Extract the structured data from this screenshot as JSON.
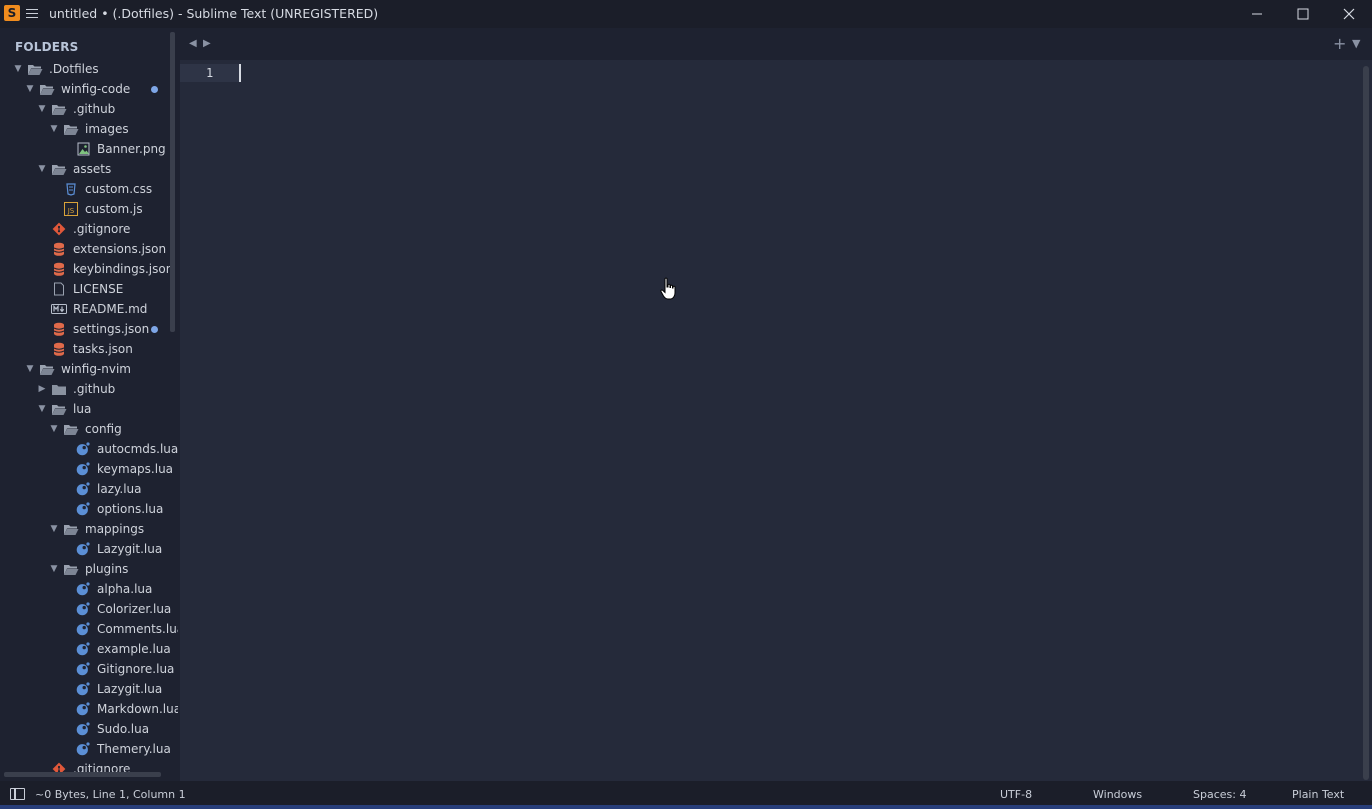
{
  "window": {
    "title": "untitled • (.Dotfiles) - Sublime Text (UNREGISTERED)",
    "app_icon": "S"
  },
  "sidebar": {
    "title": "FOLDERS",
    "items": [
      {
        "label": ".Dotfiles",
        "icon": "folder-open-icon",
        "expanded": true
      },
      {
        "label": "winfig-code",
        "icon": "folder-open-icon",
        "expanded": true,
        "modified": true
      },
      {
        "label": ".github",
        "icon": "folder-open-icon",
        "expanded": true
      },
      {
        "label": "images",
        "icon": "folder-open-icon",
        "expanded": true
      },
      {
        "label": "Banner.png",
        "icon": "image-file-icon"
      },
      {
        "label": "assets",
        "icon": "folder-open-icon",
        "expanded": true
      },
      {
        "label": "custom.css",
        "icon": "css-file-icon"
      },
      {
        "label": "custom.js",
        "icon": "js-file-icon"
      },
      {
        "label": ".gitignore",
        "icon": "git-file-icon"
      },
      {
        "label": "extensions.json",
        "icon": "json-file-icon"
      },
      {
        "label": "keybindings.json",
        "icon": "json-file-icon"
      },
      {
        "label": "LICENSE",
        "icon": "plain-file-icon"
      },
      {
        "label": "README.md",
        "icon": "markdown-file-icon"
      },
      {
        "label": "settings.json",
        "icon": "json-file-icon",
        "modified": true
      },
      {
        "label": "tasks.json",
        "icon": "json-file-icon"
      },
      {
        "label": "winfig-nvim",
        "icon": "folder-open-icon",
        "expanded": true
      },
      {
        "label": ".github",
        "icon": "folder-closed-icon",
        "expanded": false
      },
      {
        "label": "lua",
        "icon": "folder-open-icon",
        "expanded": true
      },
      {
        "label": "config",
        "icon": "folder-open-icon",
        "expanded": true
      },
      {
        "label": "autocmds.lua",
        "icon": "lua-file-icon"
      },
      {
        "label": "keymaps.lua",
        "icon": "lua-file-icon"
      },
      {
        "label": "lazy.lua",
        "icon": "lua-file-icon"
      },
      {
        "label": "options.lua",
        "icon": "lua-file-icon"
      },
      {
        "label": "mappings",
        "icon": "folder-open-icon",
        "expanded": true
      },
      {
        "label": "Lazygit.lua",
        "icon": "lua-file-icon"
      },
      {
        "label": "plugins",
        "icon": "folder-open-icon",
        "expanded": true
      },
      {
        "label": "alpha.lua",
        "icon": "lua-file-icon"
      },
      {
        "label": "Colorizer.lua",
        "icon": "lua-file-icon"
      },
      {
        "label": "Comments.lua",
        "icon": "lua-file-icon"
      },
      {
        "label": "example.lua",
        "icon": "lua-file-icon"
      },
      {
        "label": "Gitignore.lua",
        "icon": "lua-file-icon"
      },
      {
        "label": "Lazygit.lua",
        "icon": "lua-file-icon"
      },
      {
        "label": "Markdown.lua",
        "icon": "lua-file-icon"
      },
      {
        "label": "Sudo.lua",
        "icon": "lua-file-icon"
      },
      {
        "label": "Themery.lua",
        "icon": "lua-file-icon"
      },
      {
        "label": ".gitignore",
        "icon": "git-file-icon"
      }
    ]
  },
  "editor": {
    "line_numbers": [
      "1"
    ]
  },
  "status": {
    "left": "~0 Bytes, Line 1, Column 1",
    "encoding": "UTF-8",
    "line_endings": "Windows",
    "indentation": "Spaces: 4",
    "syntax": "Plain Text"
  },
  "colors": {
    "accent_orange": "#f08c1e",
    "modified_dot": "#7ea6e6",
    "lua_icon": "#5b8fd6",
    "json_icon": "#e06a4a",
    "editor_bg": "#252a3a",
    "sidebar_bg": "#1e2230"
  }
}
